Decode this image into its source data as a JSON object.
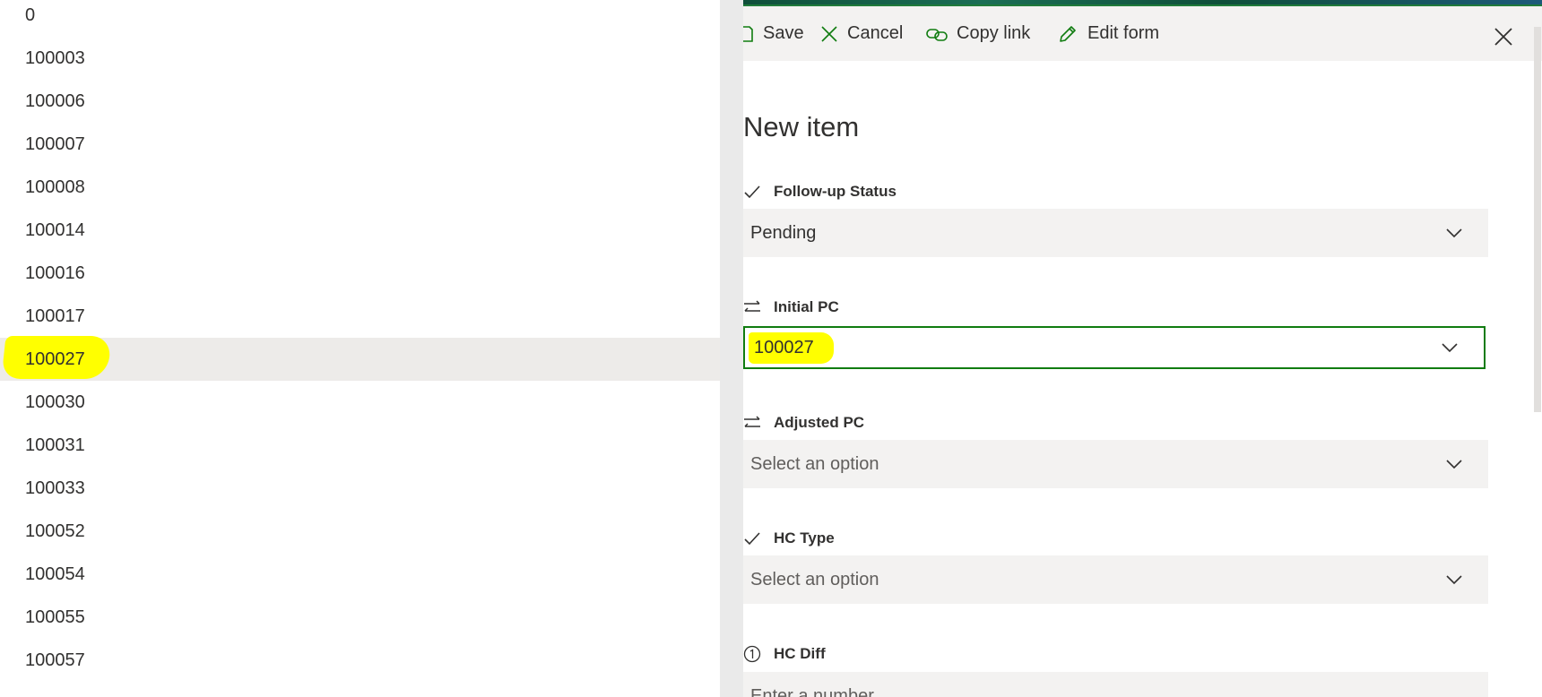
{
  "list": {
    "items": [
      "0",
      "100003",
      "100006",
      "100007",
      "100008",
      "100014",
      "100016",
      "100017",
      "100027",
      "100030",
      "100031",
      "100033",
      "100052",
      "100054",
      "100055",
      "100057"
    ],
    "selected": "100027"
  },
  "toolbar": {
    "save_label": "Save",
    "cancel_label": "Cancel",
    "copy_link_label": "Copy link",
    "edit_form_label": "Edit form"
  },
  "form": {
    "title": "New item",
    "fields": [
      {
        "label": "Follow-up Status",
        "icon": "checkmark-icon",
        "value": "Pending"
      },
      {
        "label": "Initial PC",
        "icon": "lookup-arrows-icon",
        "value": "100027"
      },
      {
        "label": "Adjusted PC",
        "icon": "lookup-arrows-icon",
        "placeholder": "Select an option"
      },
      {
        "label": "HC Type",
        "icon": "checkmark-icon",
        "placeholder": "Select an option"
      },
      {
        "label": "HC Diff",
        "icon": "number-icon",
        "placeholder": "Enter a number"
      }
    ]
  },
  "colors": {
    "accent_green": "#107c10",
    "annotation_highlight": "#ffff00",
    "selected_row": "#edebe9",
    "input_background": "#f3f2f1"
  }
}
